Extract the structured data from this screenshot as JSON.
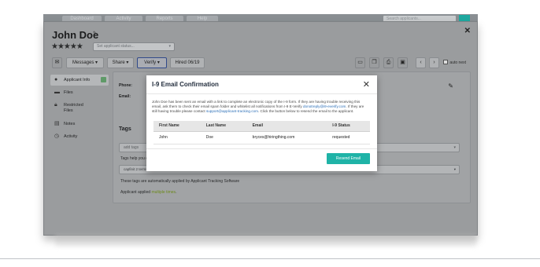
{
  "background_tabs": [
    "Dashboard",
    "Activity",
    "Reports",
    "Help"
  ],
  "background_search_placeholder": "Search applicants...",
  "applicant": {
    "name": "John Doe",
    "stars": "★★★★★",
    "status_placeholder": "Set applicant status..."
  },
  "toolbar": {
    "messages_label": "Messages ▾",
    "share_label": "Share ▾",
    "verify_label": "Verify ▾",
    "hired_label": "Hired 06/19",
    "auto_next_label": "auto next"
  },
  "sidebar": {
    "items": [
      {
        "label": "Applicant Info",
        "icon": "user-icon"
      },
      {
        "label": "Files",
        "icon": "folder-icon"
      },
      {
        "label": "Restricted",
        "label2": "Files",
        "icon": "lock-icon"
      },
      {
        "label": "Notes",
        "icon": "notes-icon"
      },
      {
        "label": "Activity",
        "icon": "activity-icon"
      }
    ]
  },
  "details": {
    "phone_label": "Phone:",
    "email_label": "Email:"
  },
  "tags": {
    "title": "Tags",
    "add_placeholder": "add tags",
    "help_text": "Tags help you o",
    "existing_tag": "capfinit 2 terms · I-9 submitted by applicant",
    "auto_text": "These tags are automatically applied by Applicant Tracking Software",
    "applied_prefix": "Applicant applied ",
    "applied_link": "multiple times",
    "applied_suffix": "."
  },
  "modal": {
    "title": "I-9 Email Confirmation",
    "body_part1": "John Doe has been sent an email with a link to complete an electronic copy of the I-9 form. If they are having trouble receiving this email, ask them to check their email spam folder and whitelist all notifications from I-9 E-Verify ",
    "body_link1": "donotreply@i9-everify.com",
    "body_part2": ". If they are still having trouble please contact ",
    "body_link2": "support@applicant-tracking.com",
    "body_part3": ". Click the button below to resend the email to the applicant.",
    "table": {
      "headers": [
        "First Name",
        "Last Name",
        "Email",
        "I-9 Status"
      ],
      "row": [
        "John",
        "Doe",
        "bryces@hiringthing.com",
        "requested"
      ]
    },
    "resend_label": "Resend Email"
  },
  "colors": {
    "accent": "#1fb3a7",
    "link": "#2c6fb7",
    "overlay": "#9a9c9e"
  }
}
